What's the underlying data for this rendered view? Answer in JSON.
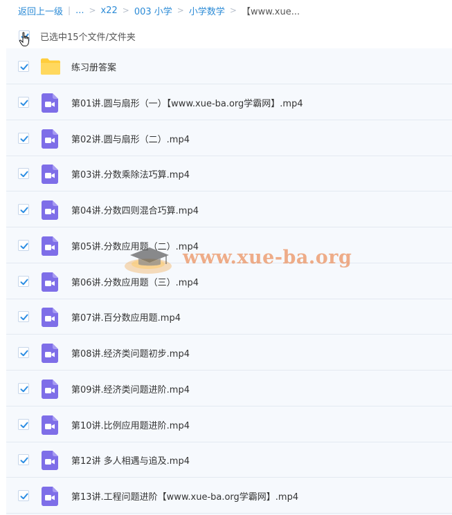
{
  "breadcrumb": {
    "back": "返回上一级",
    "divider": "|",
    "ellipsis": "...",
    "items": [
      "x22",
      "003 小学",
      "小学数学"
    ],
    "current": "【www.xue..."
  },
  "selection": {
    "label": "已选中15个文件/文件夹",
    "checked": true
  },
  "files": [
    {
      "name": "练习册答案",
      "type": "folder",
      "checked": true
    },
    {
      "name": "第01讲.圆与扇形（一）【www.xue-ba.org学霸网】.mp4",
      "type": "video",
      "checked": true
    },
    {
      "name": "第02讲.圆与扇形（二）.mp4",
      "type": "video",
      "checked": true
    },
    {
      "name": "第03讲.分数乘除法巧算.mp4",
      "type": "video",
      "checked": true
    },
    {
      "name": "第04讲.分数四则混合巧算.mp4",
      "type": "video",
      "checked": true
    },
    {
      "name": "第05讲.分数应用题（二）.mp4",
      "type": "video",
      "checked": true
    },
    {
      "name": "第06讲.分数应用题（三）.mp4",
      "type": "video",
      "checked": true
    },
    {
      "name": "第07讲.百分数应用题.mp4",
      "type": "video",
      "checked": true
    },
    {
      "name": "第08讲.经济类问题初步.mp4",
      "type": "video",
      "checked": true
    },
    {
      "name": "第09讲.经济类问题进阶.mp4",
      "type": "video",
      "checked": true
    },
    {
      "name": "第10讲.比例应用题进阶.mp4",
      "type": "video",
      "checked": true
    },
    {
      "name": "第12讲 多人相遇与追及.mp4",
      "type": "video",
      "checked": true
    },
    {
      "name": "第13讲.工程问题进阶【www.xue-ba.org学霸网】.mp4",
      "type": "video",
      "checked": true
    }
  ],
  "watermark": {
    "text": "www.xue-ba.org"
  },
  "colors": {
    "accent": "#2a8ad6",
    "checkbox": "#2b8de3",
    "folder": "#ffcd3c",
    "video": "#7e6ee8",
    "row_bg": "#f6f9fd",
    "row_border": "#e3e9f1"
  },
  "icons": {
    "checkbox": "checkmark-icon",
    "folder": "folder-icon",
    "video": "video-file-icon",
    "cursor": "hand-pointer-icon"
  }
}
